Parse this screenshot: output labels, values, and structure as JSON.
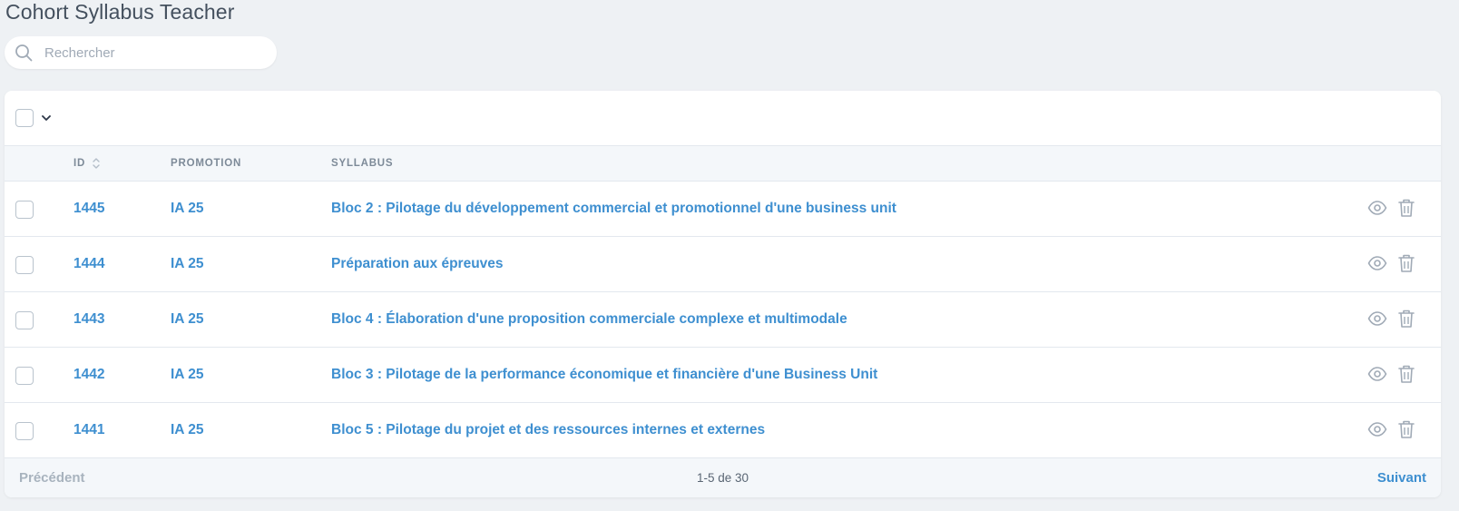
{
  "page": {
    "title": "Cohort Syllabus Teacher"
  },
  "search": {
    "placeholder": "Rechercher",
    "value": ""
  },
  "table": {
    "columns": {
      "id": "ID",
      "promotion": "PROMOTION",
      "syllabus": "SYLLABUS"
    },
    "rows": [
      {
        "id": "1445",
        "promotion": "IA 25",
        "syllabus": "Bloc 2 : Pilotage du développement commercial et promotionnel d'une business unit"
      },
      {
        "id": "1444",
        "promotion": "IA 25",
        "syllabus": "Préparation aux épreuves"
      },
      {
        "id": "1443",
        "promotion": "IA 25",
        "syllabus": "Bloc 4 : Élaboration d'une proposition commerciale complexe et multimodale"
      },
      {
        "id": "1442",
        "promotion": "IA 25",
        "syllabus": "Bloc 3 : Pilotage de la performance économique et financière d'une Business Unit"
      },
      {
        "id": "1441",
        "promotion": "IA 25",
        "syllabus": "Bloc 5 : Pilotage du projet et des ressources internes et externes"
      }
    ]
  },
  "pagination": {
    "prev_label": "Précédent",
    "info": "1-5 de 30",
    "next_label": "Suivant"
  },
  "colors": {
    "accent": "#3e8fd0",
    "background": "#eef1f4",
    "header_bg": "#f4f7fa",
    "icon": "#a0aab6"
  }
}
